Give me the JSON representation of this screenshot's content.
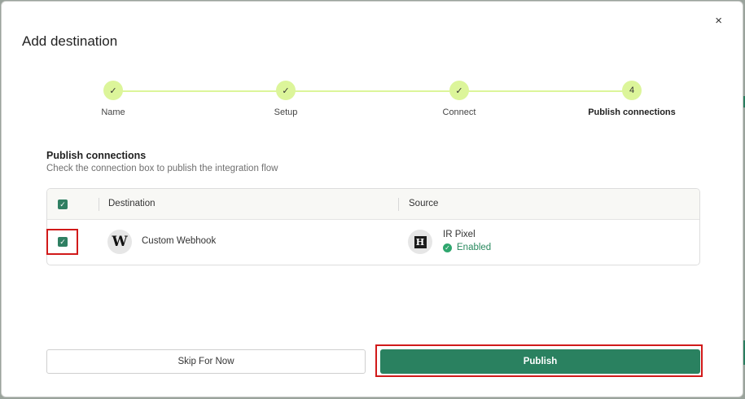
{
  "dialog": {
    "title": "Add destination",
    "close_glyph": "×"
  },
  "stepper": {
    "steps": [
      {
        "label": "Name",
        "marker": "✓",
        "state": "complete"
      },
      {
        "label": "Setup",
        "marker": "✓",
        "state": "complete"
      },
      {
        "label": "Connect",
        "marker": "✓",
        "state": "complete"
      },
      {
        "label": "Publish connections",
        "marker": "4",
        "state": "active"
      }
    ]
  },
  "publish": {
    "heading": "Publish connections",
    "description": "Check the connection box to publish the integration flow"
  },
  "table": {
    "select_all_checked": true,
    "columns": {
      "destination": "Destination",
      "source": "Source"
    },
    "rows": [
      {
        "checked": true,
        "destination_icon": "W",
        "destination_name": "Custom Webhook",
        "source_icon": "H",
        "source_name": "IR Pixel",
        "source_status": "Enabled"
      }
    ]
  },
  "footer": {
    "skip_label": "Skip For Now",
    "publish_label": "Publish"
  },
  "colors": {
    "accent": "#2a8160",
    "step_fill": "#dcf59a",
    "highlight": "#d11a1a",
    "status": "#2a8a5f"
  },
  "icons": [
    "close-icon",
    "check-icon",
    "webhook-w-icon",
    "ir-pixel-h-icon",
    "enabled-check-icon"
  ]
}
